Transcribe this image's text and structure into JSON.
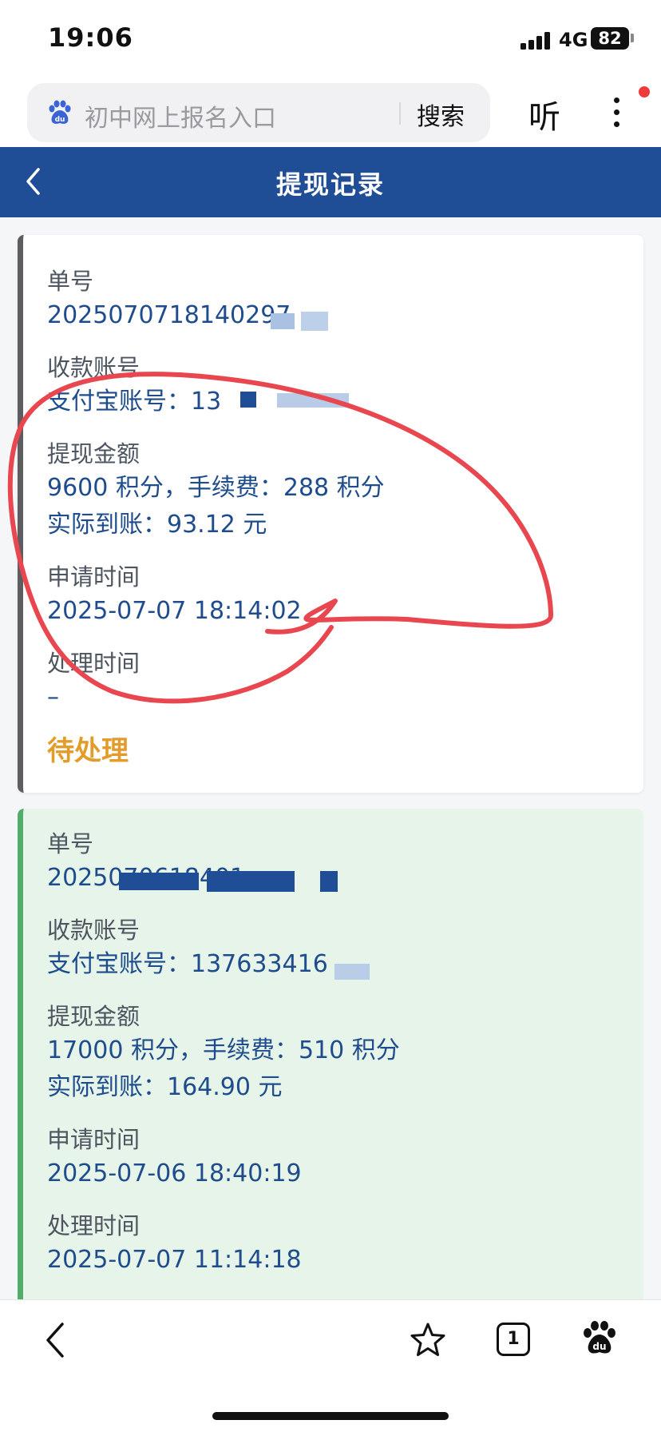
{
  "status_bar": {
    "time": "19:06",
    "network": "4G",
    "battery": "82"
  },
  "browser": {
    "search_query": "初中网上报名入口",
    "search_button": "搜索",
    "listen_button": "听"
  },
  "header": {
    "title": "提现记录"
  },
  "records": [
    {
      "order_label": "单号",
      "order_value": "2025070718140297",
      "account_label": "收款账号",
      "account_value": "支付宝账号：13",
      "amount_label": "提现金额",
      "amount_value": "9600 积分，手续费：288 积分",
      "received_value": "实际到账：93.12 元",
      "apply_label": "申请时间",
      "apply_value": "2025-07-07 18:14:02",
      "process_label": "处理时间",
      "process_value": "–",
      "status": "待处理"
    },
    {
      "order_label": "单号",
      "order_value": "2025070618401",
      "account_label": "收款账号",
      "account_value": "支付宝账号：137633416",
      "amount_label": "提现金额",
      "amount_value": "17000 积分，手续费：510 积分",
      "received_value": "实际到账：164.90 元",
      "apply_label": "申请时间",
      "apply_value": "2025-07-06 18:40:19",
      "process_label": "处理时间",
      "process_value": "2025-07-07 11:14:18"
    }
  ],
  "bottom_bar": {
    "tab_count": "1"
  },
  "colors": {
    "header": "#1f4e96",
    "value_text": "#1e4c8c",
    "pending": "#e39b2a",
    "done_card": "#e6f4e9",
    "annotation": "#e8474f"
  },
  "icons": [
    "back-chevron-icon",
    "baidu-paw-icon",
    "more-dots-icon",
    "star-icon",
    "tabs-icon",
    "baidu-home-icon"
  ]
}
